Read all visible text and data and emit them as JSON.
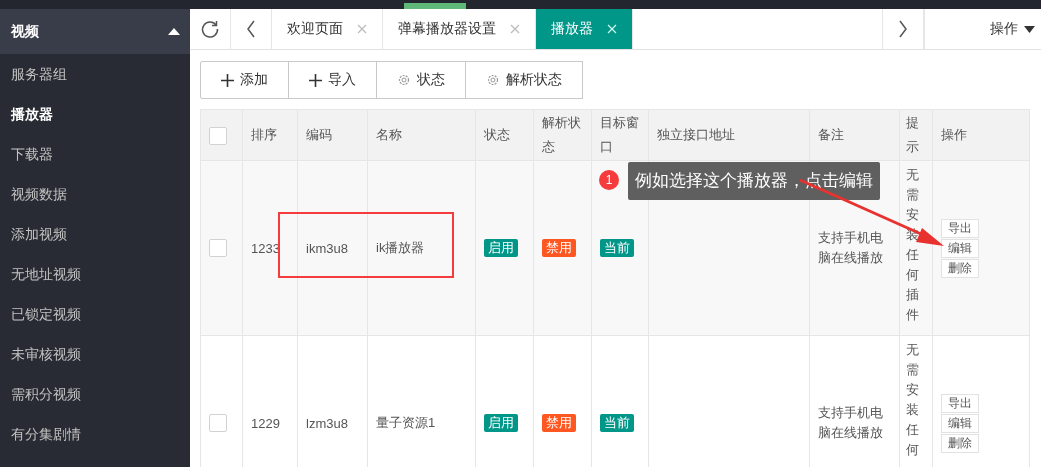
{
  "sidebar": {
    "section": {
      "label": "视频",
      "expanded": true
    },
    "items": [
      {
        "label": "服务器组",
        "selected": false
      },
      {
        "label": "播放器",
        "selected": true
      },
      {
        "label": "下载器",
        "selected": false
      },
      {
        "label": "视频数据",
        "selected": false
      },
      {
        "label": "添加视频",
        "selected": false
      },
      {
        "label": "无地址视频",
        "selected": false
      },
      {
        "label": "已锁定视频",
        "selected": false
      },
      {
        "label": "未审核视频",
        "selected": false
      },
      {
        "label": "需积分视频",
        "selected": false
      },
      {
        "label": "有分集剧情",
        "selected": false
      }
    ]
  },
  "tabs": {
    "items": [
      {
        "label": "欢迎页面",
        "selected": false
      },
      {
        "label": "弹幕播放器设置",
        "selected": false
      },
      {
        "label": "播放器",
        "selected": true
      }
    ],
    "menu": "操作"
  },
  "toolbar": [
    {
      "label": "添加",
      "kind": "plus"
    },
    {
      "label": "导入",
      "kind": "plus"
    },
    {
      "label": "状态",
      "kind": "gear"
    },
    {
      "label": "解析状态",
      "kind": "gear"
    }
  ],
  "table": {
    "select_all": false,
    "columns": [
      "排序",
      "编码",
      "名称",
      "状态",
      "解析状态",
      "目标窗口",
      "独立接口地址",
      "备注",
      "提示",
      "操作"
    ],
    "rows": [
      {
        "checked": false,
        "sort": "1233",
        "code": "ikm3u8",
        "name": "ik播放器",
        "status": {
          "text": "启用",
          "color": "#009688"
        },
        "parse": {
          "text": "禁用",
          "color": "#ff5722"
        },
        "target": {
          "text": "当前",
          "color": "#009688"
        },
        "note": "支持手机电脑在线播放",
        "hint": "无需安装任何插件",
        "actions": [
          "导出",
          "编辑",
          "删除"
        ]
      },
      {
        "checked": false,
        "sort": "1229",
        "code": "lzm3u8",
        "name": "量子资源1",
        "status": {
          "text": "启用",
          "color": "#009688"
        },
        "parse": {
          "text": "禁用",
          "color": "#ff5722"
        },
        "target": {
          "text": "当前",
          "color": "#009688"
        },
        "note": "支持手机电脑在线播放",
        "hint": "无需安装任何",
        "actions": [
          "导出",
          "编辑",
          "删除"
        ]
      }
    ]
  },
  "annotation": {
    "number": "1",
    "text": "例如选择这个播放器，点击编辑"
  }
}
